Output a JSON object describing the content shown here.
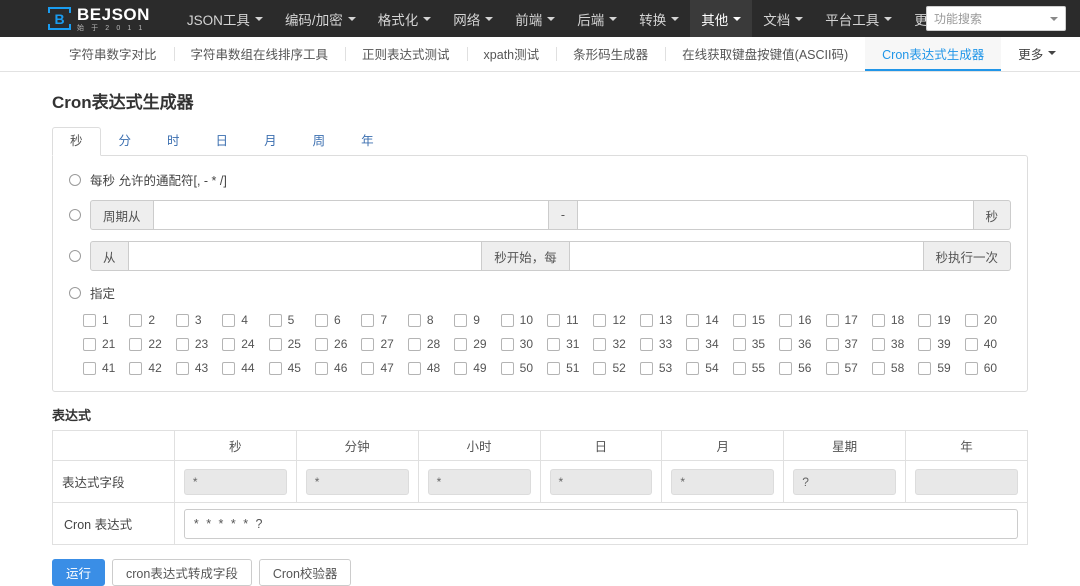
{
  "brand": {
    "name": "BEJSON",
    "tagline": "始 于 2 0 1 1",
    "mark_letter": "B",
    "accent_color": "#1a9cf0"
  },
  "navbar": {
    "items": [
      {
        "label": "JSON工具",
        "has_caret": true,
        "active": false
      },
      {
        "label": "编码/加密",
        "has_caret": true,
        "active": false
      },
      {
        "label": "格式化",
        "has_caret": true,
        "active": false
      },
      {
        "label": "网络",
        "has_caret": true,
        "active": false
      },
      {
        "label": "前端",
        "has_caret": true,
        "active": false
      },
      {
        "label": "后端",
        "has_caret": true,
        "active": false
      },
      {
        "label": "转换",
        "has_caret": true,
        "active": false
      },
      {
        "label": "其他",
        "has_caret": true,
        "active": true
      },
      {
        "label": "文档",
        "has_caret": true,
        "active": false
      },
      {
        "label": "平台工具",
        "has_caret": true,
        "active": false
      },
      {
        "label": "更多",
        "has_caret": true,
        "active": false
      }
    ],
    "search": {
      "placeholder": "功能搜索",
      "value": "功能搜索",
      "icon": "chevron-down-icon"
    }
  },
  "subnav": {
    "items": [
      {
        "label": "字符串数字对比",
        "active": false
      },
      {
        "label": "字符串数组在线排序工具",
        "active": false
      },
      {
        "label": "正则表达式测试",
        "active": false
      },
      {
        "label": "xpath测试",
        "active": false
      },
      {
        "label": "条形码生成器",
        "active": false
      },
      {
        "label": "在线获取键盘按键值(ASCII码)",
        "active": false
      },
      {
        "label": "Cron表达式生成器",
        "active": true
      }
    ],
    "more_label": "更多",
    "active_color": "#2196e8"
  },
  "page": {
    "title": "Cron表达式生成器"
  },
  "unit_tabs": [
    {
      "label": "秒",
      "active": true
    },
    {
      "label": "分",
      "active": false
    },
    {
      "label": "时",
      "active": false
    },
    {
      "label": "日",
      "active": false
    },
    {
      "label": "月",
      "active": false
    },
    {
      "label": "周",
      "active": false
    },
    {
      "label": "年",
      "active": false
    }
  ],
  "options": {
    "every": {
      "label": "每秒 允许的通配符[, - * /]",
      "selected": false
    },
    "cycle": {
      "prefix_label": "周期从",
      "separator_label": "-",
      "suffix_label": "秒",
      "from_value": "",
      "to_value": "",
      "selected": false
    },
    "interval": {
      "prefix_label": "从",
      "middle_label": "秒开始，每",
      "suffix_label": "秒执行一次",
      "start_value": "",
      "step_value": "",
      "selected": false
    },
    "specify": {
      "label": "指定",
      "selected": false,
      "values": [
        1,
        2,
        3,
        4,
        5,
        6,
        7,
        8,
        9,
        10,
        11,
        12,
        13,
        14,
        15,
        16,
        17,
        18,
        19,
        20,
        21,
        22,
        23,
        24,
        25,
        26,
        27,
        28,
        29,
        30,
        31,
        32,
        33,
        34,
        35,
        36,
        37,
        38,
        39,
        40,
        41,
        42,
        43,
        44,
        45,
        46,
        47,
        48,
        49,
        50,
        51,
        52,
        53,
        54,
        55,
        56,
        57,
        58,
        59,
        60
      ],
      "checked": []
    }
  },
  "expression": {
    "section_title": "表达式",
    "headers": [
      "",
      "秒",
      "分钟",
      "小时",
      "日",
      "月",
      "星期",
      "年"
    ],
    "field_row_label": "表达式字段",
    "field_values": [
      "*",
      "*",
      "*",
      "*",
      "*",
      "?",
      ""
    ],
    "cron_row_label": "Cron 表达式",
    "cron_value": "* * * * * ?"
  },
  "buttons": [
    {
      "label": "运行",
      "style": "primary"
    },
    {
      "label": "cron表达式转成字段",
      "style": "default"
    },
    {
      "label": "Cron校验器",
      "style": "default"
    }
  ]
}
